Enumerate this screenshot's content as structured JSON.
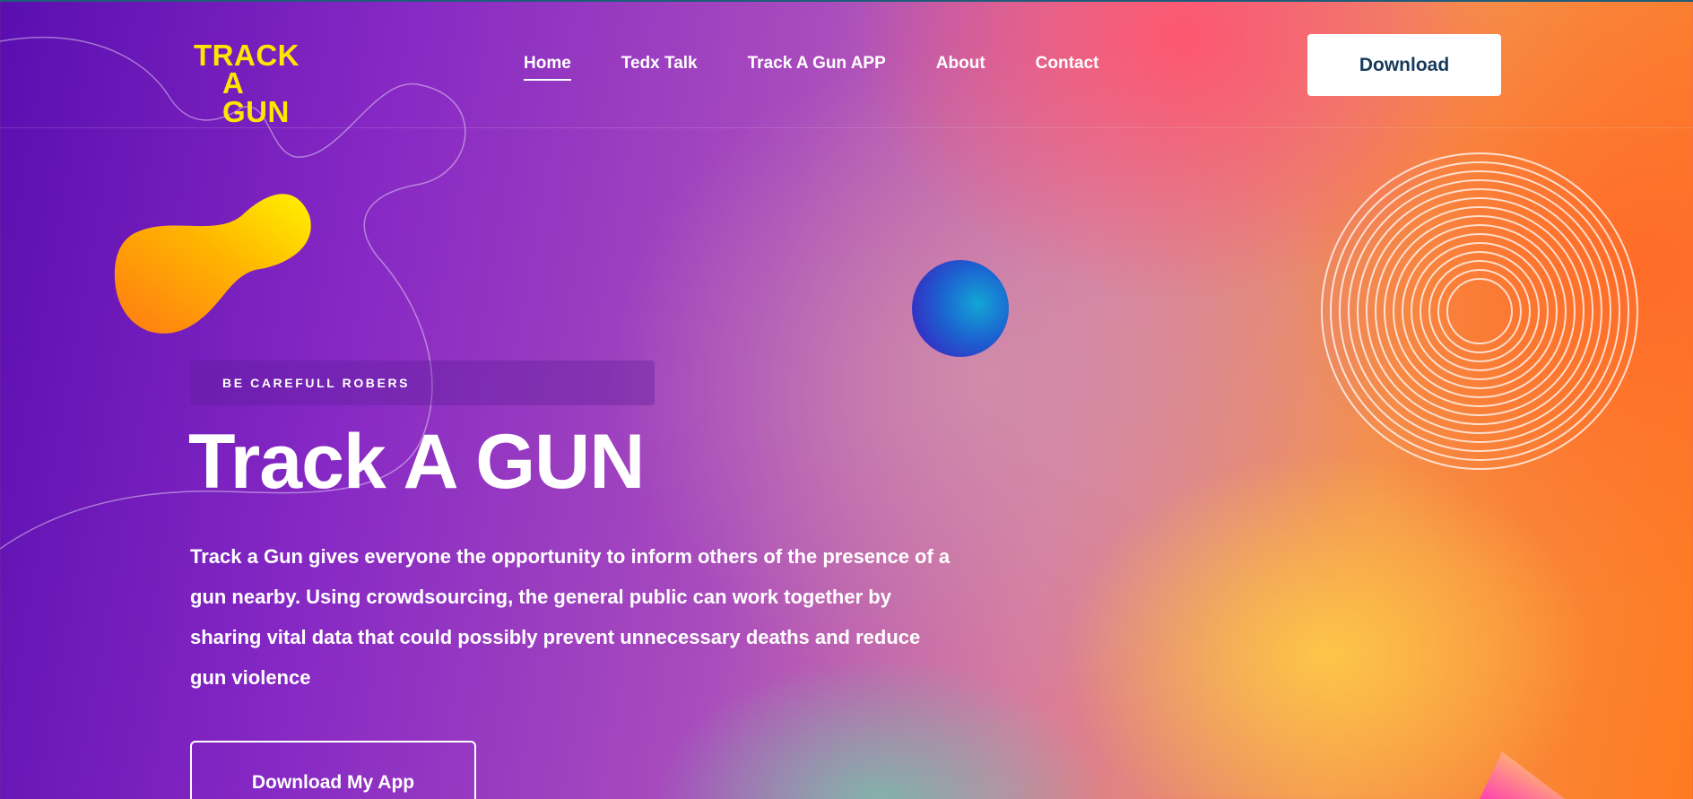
{
  "brand": {
    "line1": "TRACK",
    "line2": "A GUN"
  },
  "nav": {
    "items": [
      {
        "label": "Home",
        "active": true
      },
      {
        "label": "Tedx Talk"
      },
      {
        "label": "Track A Gun APP"
      },
      {
        "label": "About"
      },
      {
        "label": "Contact"
      }
    ]
  },
  "header": {
    "download_label": "Download"
  },
  "hero": {
    "badge": "BE CAREFULL ROBERS",
    "title": "Track A GUN",
    "description": "Track a Gun gives everyone the opportunity to inform others of the presence of a gun nearby. Using crowdsourcing, the general public can work together by sharing vital data that could possibly prevent unnecessary deaths and reduce gun violence",
    "cta_label": "Download My App"
  },
  "colors": {
    "logo": "#ffe600",
    "download_text": "#163a5a"
  }
}
